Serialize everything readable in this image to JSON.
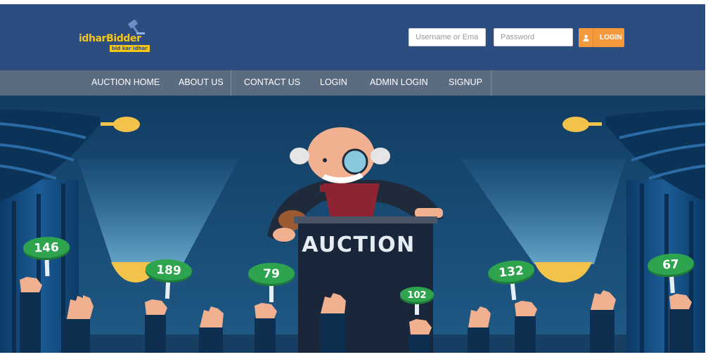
{
  "brand": {
    "name": "idharBidder",
    "tagline": "bid kar idhar",
    "logo_icon": "gavel-icon",
    "logo_color": "#f5c518"
  },
  "login_form": {
    "username_placeholder": "Username or Email",
    "password_placeholder": "Password",
    "button_label": "LOGIN",
    "button_icon": "user-icon",
    "button_color": "#f59a3c"
  },
  "nav": {
    "items": [
      {
        "label": "AUCTION HOME"
      },
      {
        "label": "ABOUT US"
      },
      {
        "label": "CONTACT US"
      },
      {
        "label": "LOGIN"
      },
      {
        "label": "ADMIN LOGIN"
      },
      {
        "label": "SIGNUP"
      }
    ]
  },
  "hero": {
    "podium_text": "AUCTION",
    "paddles": [
      "146",
      "189",
      "79",
      "102",
      "132",
      "67"
    ],
    "colors": {
      "header": "#2c4d80",
      "nav": "#5b6c80",
      "background": "#1b4a72",
      "paddle": "#2ea44f"
    }
  }
}
